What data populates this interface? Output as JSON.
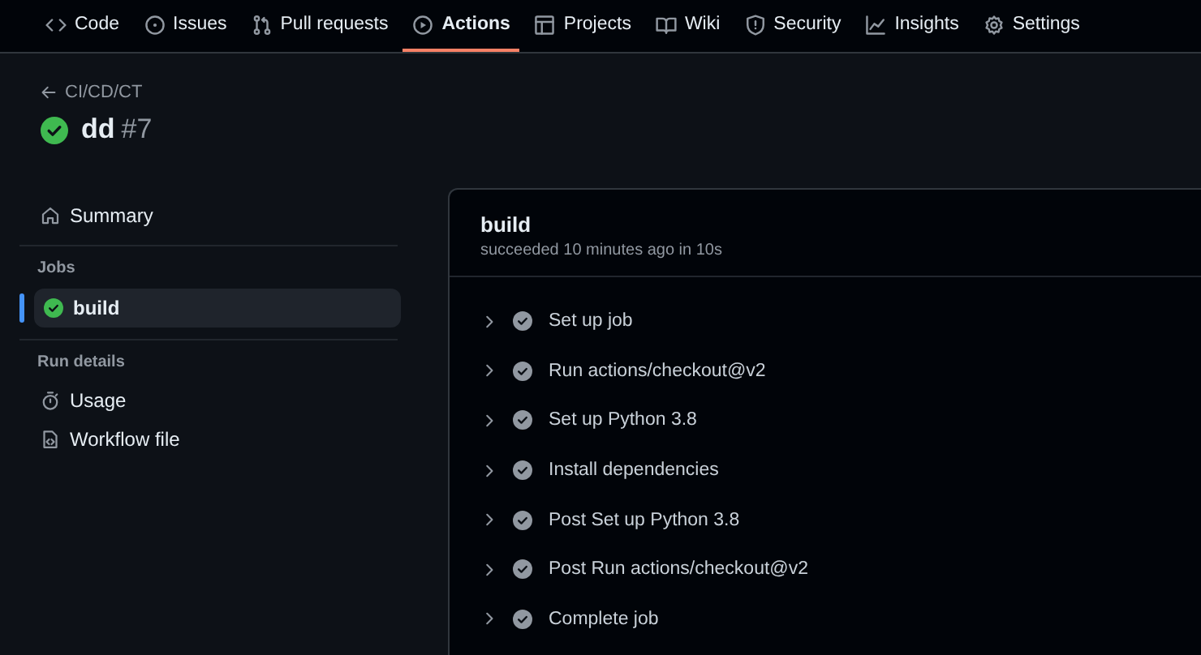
{
  "nav_tabs": [
    {
      "label": "Code",
      "selected": false
    },
    {
      "label": "Issues",
      "selected": false
    },
    {
      "label": "Pull requests",
      "selected": false
    },
    {
      "label": "Actions",
      "selected": true
    },
    {
      "label": "Projects",
      "selected": false
    },
    {
      "label": "Wiki",
      "selected": false
    },
    {
      "label": "Security",
      "selected": false
    },
    {
      "label": "Insights",
      "selected": false
    },
    {
      "label": "Settings",
      "selected": false
    }
  ],
  "breadcrumb": "CI/CD/CT",
  "run": {
    "title": "dd",
    "number": "#7",
    "passed": true
  },
  "sidebar": {
    "summary": "Summary",
    "jobs_heading": "Jobs",
    "jobs": [
      {
        "name": "build",
        "passed": true,
        "selected": true
      }
    ],
    "details_heading": "Run details",
    "details": [
      "Usage",
      "Workflow file"
    ]
  },
  "job": {
    "title": "build",
    "subtitle": "succeeded 10 minutes ago in 10s",
    "steps": [
      {
        "name": "Set up job",
        "passed": true,
        "expanded": false
      },
      {
        "name": "Run actions/checkout@v2",
        "passed": true,
        "expanded": false
      },
      {
        "name": "Set up Python 3.8",
        "passed": true,
        "expanded": false
      },
      {
        "name": "Install dependencies",
        "passed": true,
        "expanded": false
      },
      {
        "name": "Post Set up Python 3.8",
        "passed": true,
        "expanded": false
      },
      {
        "name": "Post Run actions/checkout@v2",
        "passed": true,
        "expanded": false
      },
      {
        "name": "Complete job",
        "passed": true,
        "expanded": false
      }
    ]
  }
}
